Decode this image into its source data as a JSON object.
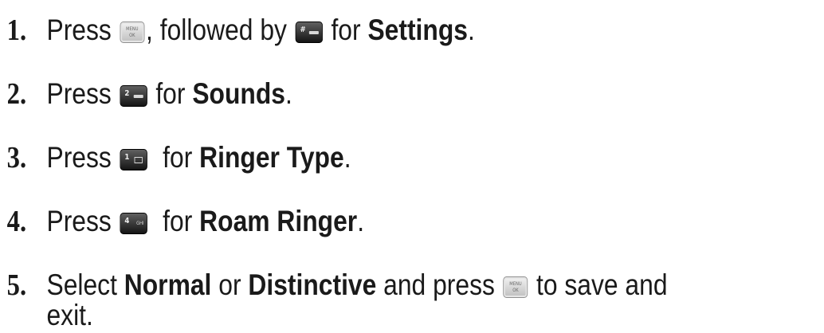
{
  "steps": [
    {
      "number": "1.",
      "press": "Press",
      "comma_followed": ", followed by",
      "for": "for",
      "target": "Settings",
      "period": "."
    },
    {
      "number": "2.",
      "press": "Press",
      "for": "for",
      "target": "Sounds",
      "period": "."
    },
    {
      "number": "3.",
      "press": "Press",
      "for": "for",
      "target": "Ringer Type",
      "period": "."
    },
    {
      "number": "4.",
      "press": "Press",
      "for": "for",
      "target": "Roam Ringer",
      "period": "."
    },
    {
      "number": "5.",
      "select": "Select",
      "option1": "Normal",
      "or": "or",
      "option2": "Distinctive",
      "and_press": "and press",
      "save_exit_line1": "to save and",
      "save_exit_line2": "exit."
    }
  ],
  "keys": {
    "menu_ok": {
      "top": "MENU",
      "bottom": "OK"
    },
    "pound": {
      "label": "#"
    },
    "two": {
      "label": "2"
    },
    "one": {
      "label": "1"
    },
    "four": {
      "label": "4",
      "letters": "GHI"
    }
  }
}
